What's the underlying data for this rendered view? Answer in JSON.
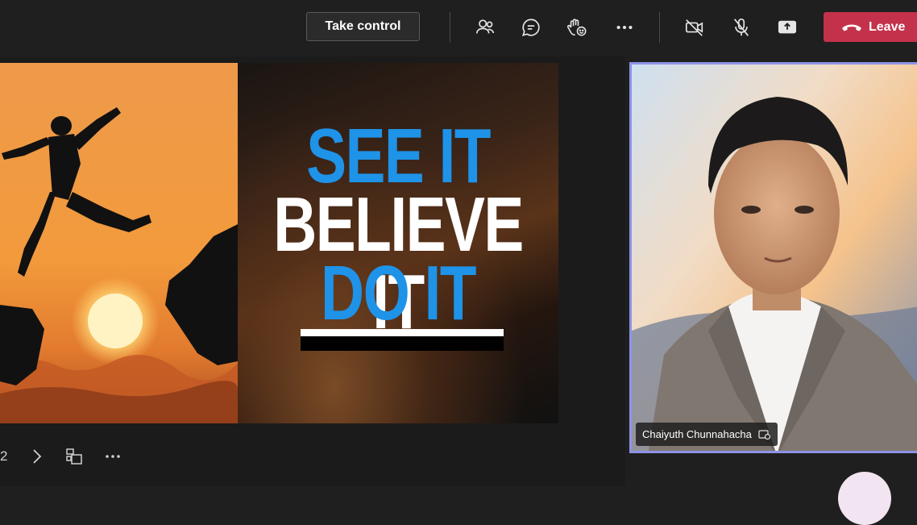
{
  "toolbar": {
    "take_control_label": "Take control",
    "icons": [
      "participants-icon",
      "chat-icon",
      "reactions-icon",
      "more-icon",
      "camera-off-icon",
      "mic-off-icon",
      "share-icon"
    ],
    "leave_label": "Leave",
    "leave_color": "#c4314b"
  },
  "slide": {
    "line1": "SEE IT",
    "line2": "BELIEVE IT",
    "line3": "DO IT",
    "accent_color": "#1e93e8"
  },
  "slide_nav": {
    "page_number": "2"
  },
  "participant": {
    "name": "Chaiyuth Chunnahacha",
    "border_color": "#8e93e6"
  }
}
